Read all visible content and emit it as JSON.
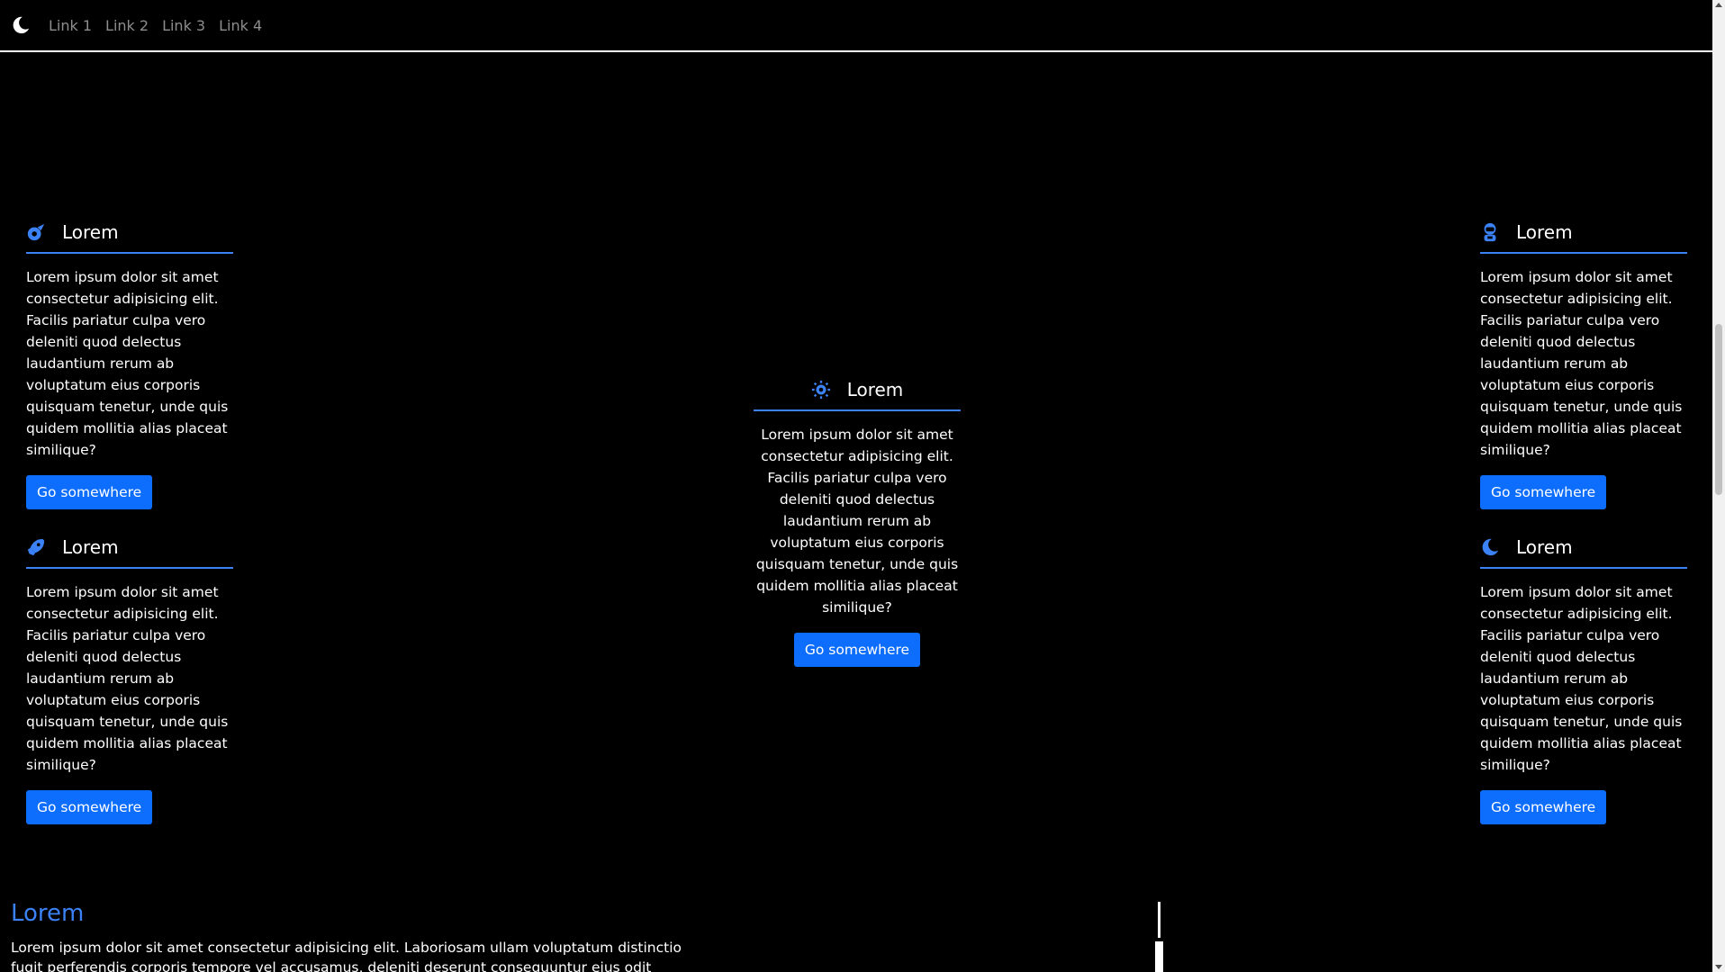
{
  "nav": {
    "links": [
      "Link 1",
      "Link 2",
      "Link 3",
      "Link 4"
    ]
  },
  "cards": {
    "top_left": {
      "title": "Lorem",
      "text": "Lorem ipsum dolor sit amet consectetur adipisicing elit. Facilis pariatur culpa vero deleniti quod delectus laudantium rerum ab voluptatum eius corporis quisquam tenetur, unde quis quidem mollitia alias placeat similique?",
      "button": "Go somewhere",
      "icon": "comet-icon"
    },
    "bottom_left": {
      "title": "Lorem",
      "text": "Lorem ipsum dolor sit amet consectetur adipisicing elit. Facilis pariatur culpa vero deleniti quod delectus laudantium rerum ab voluptatum eius corporis quisquam tenetur, unde quis quidem mollitia alias placeat similique?",
      "button": "Go somewhere",
      "icon": "rocket-icon"
    },
    "center": {
      "title": "Lorem",
      "text": "Lorem ipsum dolor sit amet consectetur adipisicing elit. Facilis pariatur culpa vero deleniti quod delectus laudantium rerum ab voluptatum eius corporis quisquam tenetur, unde quis quidem mollitia alias placeat similique?",
      "button": "Go somewhere",
      "icon": "sun-icon"
    },
    "top_right": {
      "title": "Lorem",
      "text": "Lorem ipsum dolor sit amet consectetur adipisicing elit. Facilis pariatur culpa vero deleniti quod delectus laudantium rerum ab voluptatum eius corporis quisquam tenetur, unde quis quidem mollitia alias placeat similique?",
      "button": "Go somewhere",
      "icon": "astronaut-icon"
    },
    "bottom_right": {
      "title": "Lorem",
      "text": "Lorem ipsum dolor sit amet consectetur adipisicing elit. Facilis pariatur culpa vero deleniti quod delectus laudantium rerum ab voluptatum eius corporis quisquam tenetur, unde quis quidem mollitia alias placeat similique?",
      "button": "Go somewhere",
      "icon": "moon-icon"
    }
  },
  "section": {
    "title": "Lorem",
    "text": "Lorem ipsum dolor sit amet consectetur adipisicing elit. Laboriosam ullam voluptatum distinctio fugit perferendis corporis tempore vel accusamus, deleniti deserunt consequuntur eius odit laudantium?"
  },
  "colors": {
    "accent": "#3b82f6",
    "button": "#0d6efd",
    "background": "#000000"
  }
}
